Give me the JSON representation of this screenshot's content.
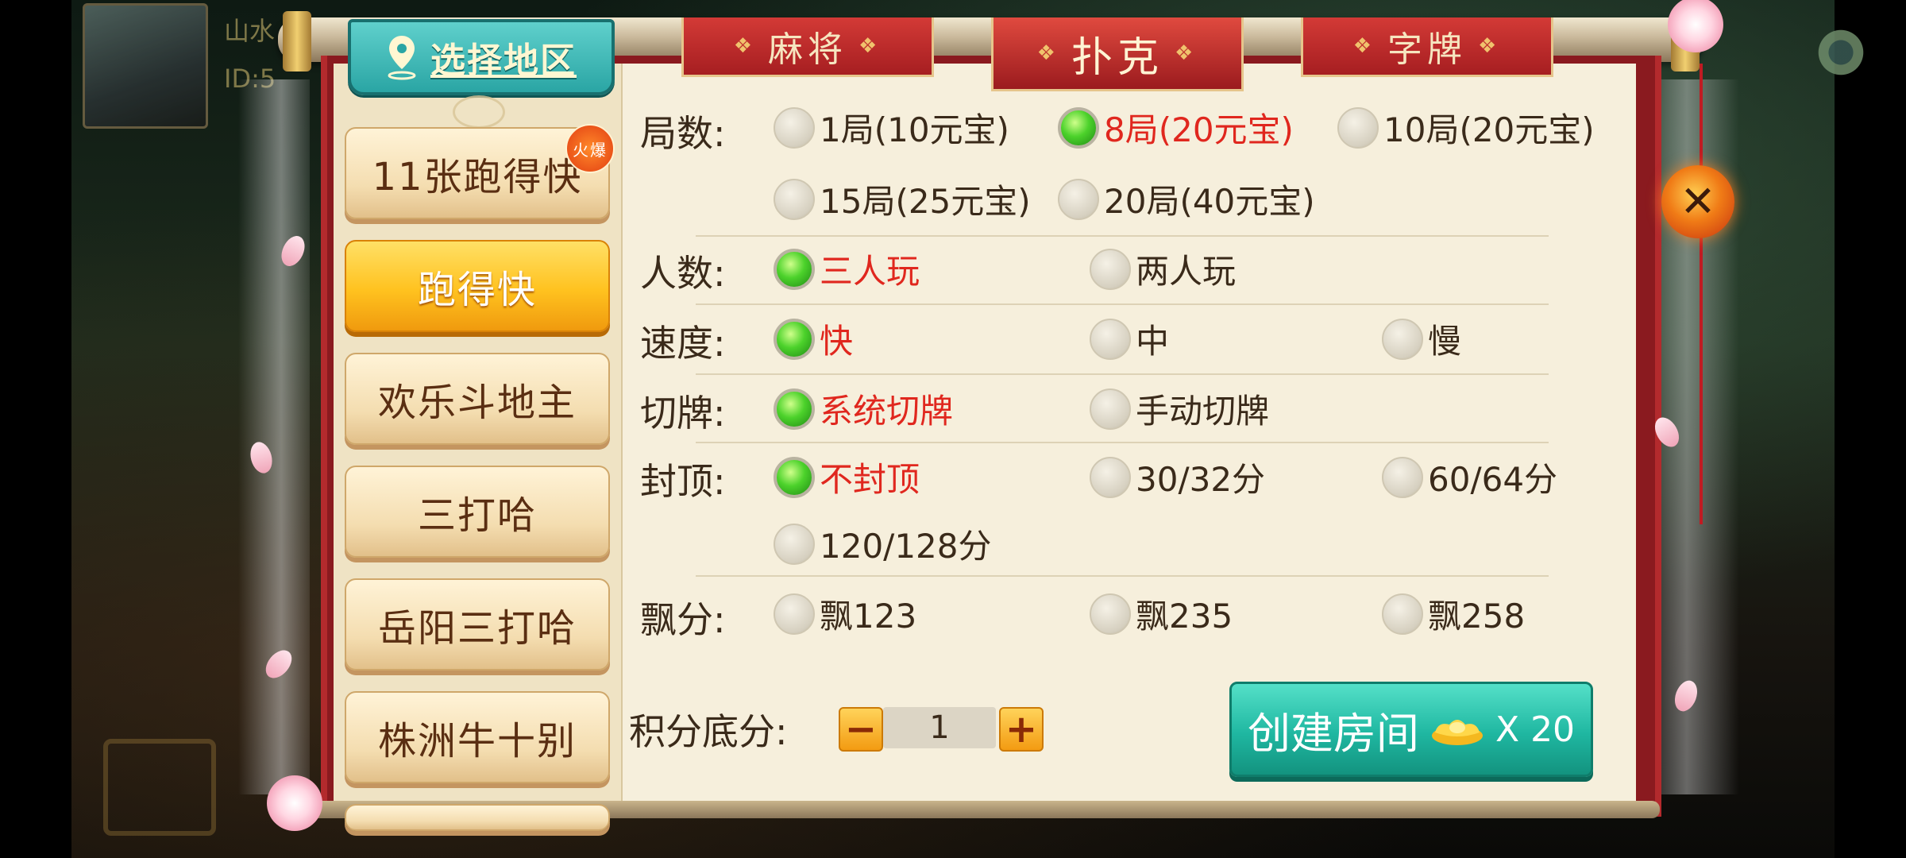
{
  "player": {
    "name": "山水",
    "id": "ID:5"
  },
  "region": {
    "label": "选择地区"
  },
  "tabs": [
    {
      "label": "麻将",
      "selected": false
    },
    {
      "label": "扑克",
      "selected": true
    },
    {
      "label": "字牌",
      "selected": false
    }
  ],
  "games": [
    {
      "label": "11张跑得快",
      "badge": "火爆",
      "selected": false
    },
    {
      "label": "跑得快",
      "selected": true
    },
    {
      "label": "欢乐斗地主",
      "selected": false
    },
    {
      "label": "三打哈",
      "selected": false
    },
    {
      "label": "岳阳三打哈",
      "selected": false
    },
    {
      "label": "株洲牛十别",
      "selected": false
    }
  ],
  "options": {
    "rounds": {
      "label": "局数:",
      "choices": [
        "1局(10元宝)",
        "8局(20元宝)",
        "10局(20元宝)",
        "15局(25元宝)",
        "20局(40元宝)"
      ],
      "selected": "8局(20元宝)"
    },
    "players": {
      "label": "人数:",
      "choices": [
        "三人玩",
        "两人玩"
      ],
      "selected": "三人玩"
    },
    "speed": {
      "label": "速度:",
      "choices": [
        "快",
        "中",
        "慢"
      ],
      "selected": "快"
    },
    "cut": {
      "label": "切牌:",
      "choices": [
        "系统切牌",
        "手动切牌"
      ],
      "selected": "系统切牌"
    },
    "cap": {
      "label": "封顶:",
      "choices": [
        "不封顶",
        "30/32分",
        "60/64分",
        "120/128分"
      ],
      "selected": "不封顶"
    },
    "float": {
      "label": "飘分:",
      "choices": [
        "飘123",
        "飘235",
        "飘258"
      ],
      "selected": null
    }
  },
  "score": {
    "label": "积分底分:",
    "minus": "−",
    "plus": "+",
    "value": "1"
  },
  "create": {
    "label": "创建房间",
    "cost": "X 20"
  },
  "close": {
    "symbol": "✕"
  },
  "colors": {
    "selected_text": "#e0271e",
    "accent_teal": "#1fb7a1",
    "frame_red": "#8a1a1f"
  }
}
